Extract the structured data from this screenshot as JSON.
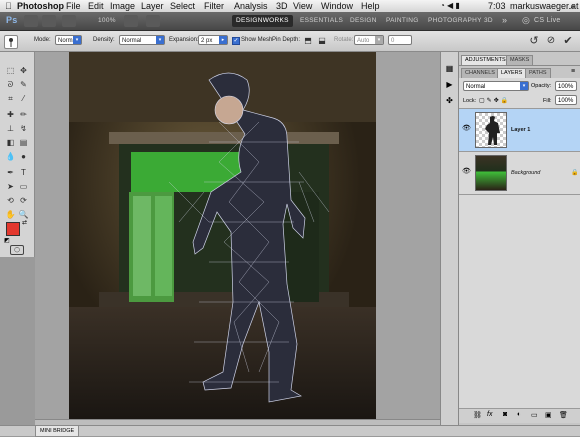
{
  "menubar": {
    "apple": "",
    "app": "Photoshop",
    "items": [
      "File",
      "Edit",
      "Image",
      "Layer",
      "Select",
      "Filter",
      "Analysis",
      "3D",
      "View",
      "Window",
      "Help"
    ],
    "time": "7:03",
    "user": "markuswaeger.at"
  },
  "appbar": {
    "logo": "Ps",
    "zoom": "100%",
    "workspaces": [
      "DESIGNWORKS",
      "ESSENTIALS",
      "DESIGN",
      "PAINTING",
      "PHOTOGRAPHY",
      "3D"
    ],
    "active_workspace": "DESIGNWORKS",
    "more": "»",
    "cs_live": "CS Live"
  },
  "options": {
    "mode_label": "Mode:",
    "mode_value": "Normal",
    "density_label": "Density:",
    "density_value": "Normal",
    "expansion_label": "Expansion:",
    "expansion_value": "2 px",
    "show_mesh_label": "Show Mesh",
    "pin_depth_label": "Pin Depth:",
    "rotate_label": "Rotate:",
    "rotate_value": "Auto",
    "rotate_degrees": "0"
  },
  "panels": {
    "top_tabs": [
      "ADJUSTMENTS",
      "MASKS"
    ],
    "layer_tabs": [
      "CHANNELS",
      "LAYERS",
      "PATHS"
    ],
    "active_layer_tab": "LAYERS",
    "blend_mode": "Normal",
    "opacity_label": "Opacity:",
    "opacity_value": "100%",
    "lock_label": "Lock:",
    "fill_label": "Fill:",
    "fill_value": "100%",
    "layers": [
      {
        "name": "Layer 1",
        "selected": true
      },
      {
        "name": "Background",
        "selected": false
      }
    ]
  },
  "bottom": {
    "minibridge_label": "MINI BRIDGE"
  },
  "colors": {
    "foreground": "#e3382e",
    "background": "#ffffff",
    "selection": "#b4d4f5",
    "accent": "#3a6fd0"
  }
}
